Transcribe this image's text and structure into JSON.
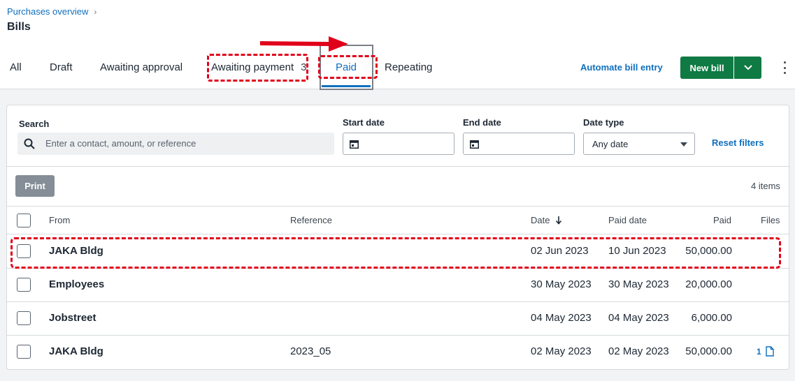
{
  "header": {
    "breadcrumb": "Purchases overview",
    "title": "Bills"
  },
  "tabs": [
    {
      "label": "All"
    },
    {
      "label": "Draft"
    },
    {
      "label": "Awaiting approval"
    },
    {
      "label": "Awaiting payment",
      "count": "3"
    },
    {
      "label": "Paid",
      "active": true
    },
    {
      "label": "Repeating"
    }
  ],
  "actions": {
    "automate_label": "Automate bill entry",
    "new_bill_label": "New bill"
  },
  "filters": {
    "search_label": "Search",
    "search_placeholder": "Enter a contact, amount, or reference",
    "start_date_label": "Start date",
    "end_date_label": "End date",
    "date_type_label": "Date type",
    "date_type_value": "Any date",
    "reset_label": "Reset filters"
  },
  "toolbar": {
    "print_label": "Print",
    "items_count": "4 items"
  },
  "table": {
    "columns": {
      "from": "From",
      "reference": "Reference",
      "date": "Date",
      "paid_date": "Paid date",
      "paid": "Paid",
      "files": "Files"
    },
    "rows": [
      {
        "from": "JAKA Bldg",
        "reference": "",
        "date": "02 Jun 2023",
        "paid_date": "10 Jun 2023",
        "paid": "50,000.00",
        "files": ""
      },
      {
        "from": "Employees",
        "reference": "",
        "date": "30 May 2023",
        "paid_date": "30 May 2023",
        "paid": "20,000.00",
        "files": ""
      },
      {
        "from": "Jobstreet",
        "reference": "",
        "date": "04 May 2023",
        "paid_date": "04 May 2023",
        "paid": "6,000.00",
        "files": ""
      },
      {
        "from": "JAKA Bldg",
        "reference": "2023_05",
        "date": "02 May 2023",
        "paid_date": "02 May 2023",
        "paid": "50,000.00",
        "files": "1"
      }
    ]
  },
  "colors": {
    "accent": "#0f6fbd",
    "primary_button": "#0f7a43",
    "annotation": "#e1001a"
  }
}
